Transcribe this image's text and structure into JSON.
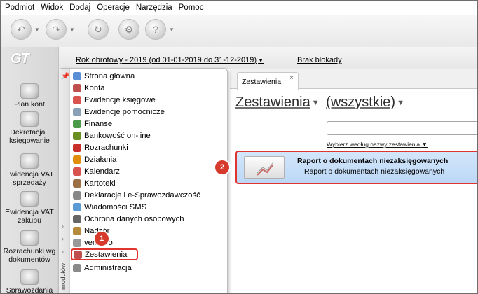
{
  "menubar": [
    "Podmiot",
    "Widok",
    "Dodaj",
    "Operacje",
    "Narzędzia",
    "Pomoc"
  ],
  "toolbar": {
    "icons": [
      "back-arrow-icon",
      "forward-arrow-icon",
      "refresh-icon",
      "settings-icon",
      "help-icon"
    ]
  },
  "sidebar": {
    "logo": "GT",
    "items": [
      {
        "label": "Plan kont",
        "icon": "plan-kont-icon"
      },
      {
        "label": "Dekretacja i księgowanie",
        "icon": "dekretacja-icon"
      },
      {
        "label": "Ewidencja VAT sprzedaży",
        "icon": "vat-sprzedaz-icon"
      },
      {
        "label": "Ewidencja VAT zakupu",
        "icon": "vat-zakup-icon"
      },
      {
        "label": "Rozrachunki wg dokumentów",
        "icon": "rozrachunki-icon"
      },
      {
        "label": "Sprawozdania",
        "icon": "sprawozdania-icon"
      }
    ]
  },
  "infobar": {
    "rok_obrotowy": "Rok obrotowy - 2019  (od 01-01-2019 do 31-12-2019)",
    "brak_blokady": "Brak blokady"
  },
  "modules_menu": {
    "vertical_label": "modułów",
    "items": [
      {
        "label": "Strona główna",
        "color": "#5a8fd6"
      },
      {
        "label": "Konta",
        "color": "#c0504d"
      },
      {
        "label": "Ewidencje księgowe",
        "color": "#d9534f"
      },
      {
        "label": "Ewidencje pomocnicze",
        "color": "#8aa0b7"
      },
      {
        "label": "Finanse",
        "color": "#4a9a4a"
      },
      {
        "label": "Bankowość on-line",
        "color": "#6b8e23"
      },
      {
        "label": "Rozrachunki",
        "color": "#c9302c"
      },
      {
        "label": "Działania",
        "color": "#e08e0b"
      },
      {
        "label": "Kalendarz",
        "color": "#d9534f"
      },
      {
        "label": "Kartoteki",
        "color": "#9c6f44"
      },
      {
        "label": "Deklaracje i e-Sprawozdawczość",
        "color": "#888888"
      },
      {
        "label": "Wiadomości SMS",
        "color": "#5b9bd5"
      },
      {
        "label": "Ochrona danych osobowych",
        "color": "#666666"
      },
      {
        "label": "Nadzór",
        "color": "#b58a3c"
      },
      {
        "label": "vendero",
        "color": "#999999"
      },
      {
        "label": "Zestawienia",
        "color": "#c0504d"
      },
      {
        "label": "Administracja",
        "color": "#8a8a8a"
      }
    ]
  },
  "tab": {
    "label": "Zestawienia",
    "close": "×"
  },
  "heading": {
    "title": "Zestawienia",
    "filter": "(wszystkie)"
  },
  "search": {
    "value": "",
    "placeholder": ""
  },
  "sort_label": "Wybierz według nazwy zestawienia",
  "report": {
    "title": "Raport o dokumentach niezaksięgowanych",
    "subtitle": "Raport o dokumentach niezaksięgowanych"
  },
  "badges": {
    "one": "1",
    "two": "2"
  },
  "colors": {
    "highlight": "#e0352e",
    "selection": "#c7dff8"
  }
}
